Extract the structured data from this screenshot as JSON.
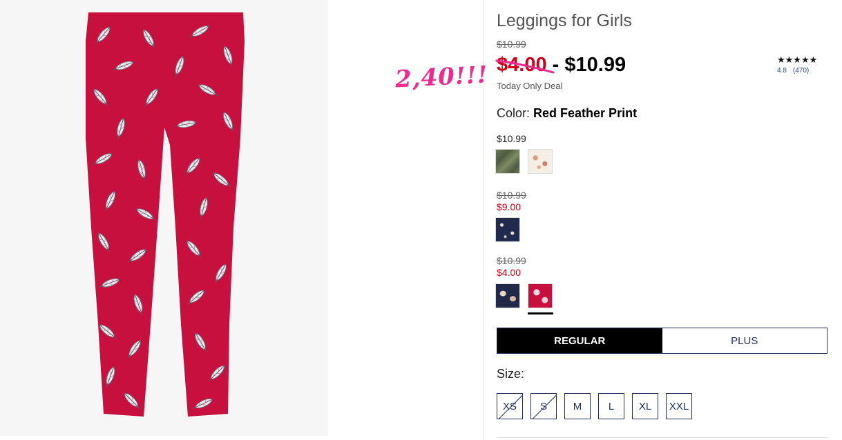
{
  "product": {
    "title": "Leggings for Girls",
    "original_price": "$10.99",
    "price_low": "$4.00",
    "price_separator": "-",
    "price_high": "$10.99",
    "deal_label": "Today Only Deal",
    "image_alt": "red leggings with feather print"
  },
  "annotation": {
    "text": "2,40!!!",
    "color": "#ee2a8f"
  },
  "rating": {
    "stars": "★★★★★",
    "score": "4.8",
    "count": "(470)"
  },
  "color": {
    "label": "Color:",
    "selected": "Red Feather Print"
  },
  "swatch_groups": [
    {
      "price": "$10.99",
      "swatches": [
        "camo-green",
        "cream-floral"
      ]
    },
    {
      "original_price": "$10.99",
      "sale_price": "$9.00",
      "swatches": [
        "navy-feather"
      ]
    },
    {
      "original_price": "$10.99",
      "sale_price": "$4.00",
      "swatches": [
        "navy-paisley",
        "red-feather"
      ],
      "selected": "red-feather"
    }
  ],
  "fit": {
    "options": [
      "REGULAR",
      "PLUS"
    ],
    "selected": "REGULAR"
  },
  "size": {
    "label": "Size:",
    "options": [
      {
        "label": "XS",
        "available": false
      },
      {
        "label": "S",
        "available": false
      },
      {
        "label": "M",
        "available": true
      },
      {
        "label": "L",
        "available": true
      },
      {
        "label": "XL",
        "available": true
      },
      {
        "label": "XXL",
        "available": true
      }
    ]
  },
  "colors": {
    "sale_red": "#d0021b",
    "navy": "#1f2f5a",
    "annotation_pink": "#ee2a8f",
    "leggings_red": "#c8103f"
  }
}
